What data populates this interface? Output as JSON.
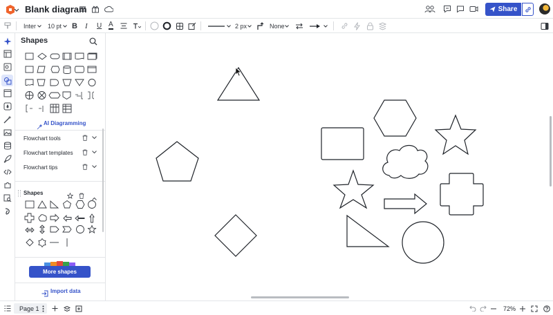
{
  "app": {
    "title": "Blank diagram"
  },
  "header": {
    "share_label": "Share"
  },
  "toolbar": {
    "font_family": "Inter",
    "font_size": "10 pt",
    "bold": "B",
    "italic": "I",
    "underline": "U",
    "text_color": "A",
    "line_width": "2 px",
    "arrow_start": "None"
  },
  "panel": {
    "title": "Shapes",
    "ai_label": "AI Diagramming",
    "libraries": [
      "Flowchart tools",
      "Flowchart templates",
      "Flowchart tips"
    ],
    "shapes_section": "Shapes",
    "more_shapes": "More shapes",
    "import_data": "Import data"
  },
  "footer": {
    "page_label": "Page 1",
    "zoom": "72%"
  },
  "colors": {
    "accent": "#3553c9",
    "stroke": "#1f2329"
  }
}
